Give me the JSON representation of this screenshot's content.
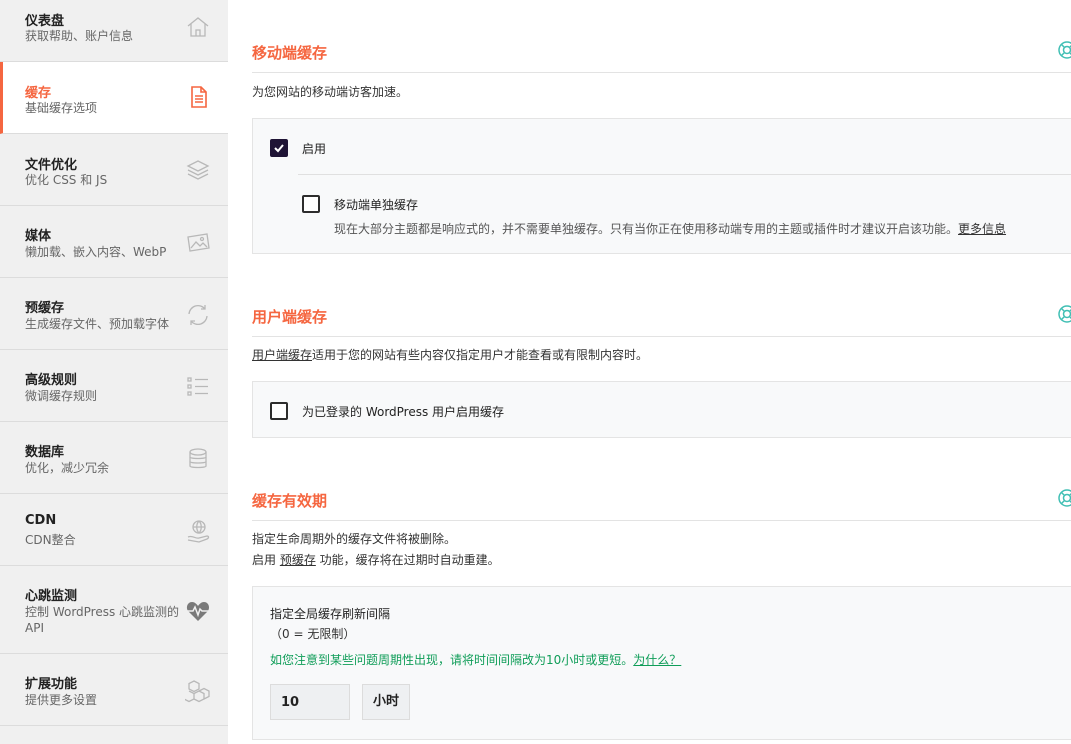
{
  "sidebar": {
    "items": [
      {
        "title": "仪表盘",
        "desc": "获取帮助、账户信息",
        "icon": "home-icon",
        "active": false
      },
      {
        "title": "缓存",
        "desc": "基础缓存选项",
        "icon": "file-icon",
        "active": true
      },
      {
        "title": "文件优化",
        "desc": "优化 CSS 和 JS",
        "icon": "layers-icon",
        "active": false
      },
      {
        "title": "媒体",
        "desc": "懒加载、嵌入内容、WebP",
        "icon": "image-icon",
        "active": false
      },
      {
        "title": "预缓存",
        "desc": "生成缓存文件、预加载字体",
        "icon": "refresh-icon",
        "active": false
      },
      {
        "title": "高级规则",
        "desc": "微调缓存规则",
        "icon": "list-icon",
        "active": false
      },
      {
        "title": "数据库",
        "desc": "优化，减少冗余",
        "icon": "database-icon",
        "active": false
      },
      {
        "title": "CDN",
        "desc": "CDN整合",
        "icon": "globe-hand-icon",
        "active": false
      },
      {
        "title": "心跳监测",
        "desc": "控制 WordPress 心跳监测的 API",
        "icon": "heartbeat-icon",
        "active": false
      },
      {
        "title": "扩展功能",
        "desc": "提供更多设置",
        "icon": "cubes-icon",
        "active": false
      }
    ]
  },
  "mobile_cache": {
    "title": "移动端缓存",
    "desc": "为您网站的移动端访客加速。",
    "enable_label": "启用",
    "enable_checked": true,
    "separate_label": "移动端单独缓存",
    "separate_checked": false,
    "separate_desc": "现在大部分主题都是响应式的，并不需要单独缓存。只有当你正在使用移动端专用的主题或插件时才建议开启该功能。",
    "more_info": "更多信息"
  },
  "user_cache": {
    "title": "用户端缓存",
    "desc_link": "用户端缓存",
    "desc_rest": "适用于您的网站有些内容仅指定用户才能查看或有限制内容时。",
    "option_label": "为已登录的 WordPress 用户启用缓存",
    "option_checked": false
  },
  "cache_lifespan": {
    "title": "缓存有效期",
    "desc_line1": "指定生命周期外的缓存文件将被删除。",
    "desc_line2_prefix": "启用 ",
    "desc_line2_link": "预缓存",
    "desc_line2_suffix": " 功能，缓存将在过期时自动重建。",
    "field_label": "指定全局缓存刷新间隔",
    "field_hint": "（0 = 无限制）",
    "note": "如您注意到某些问题周期性出现，请将时间间隔改为10小时或更短。",
    "note_link": "为什么？",
    "value": "10",
    "unit": "小时"
  },
  "colors": {
    "accent": "#f56640",
    "checkbox_checked": "#1f1435",
    "note_green": "#0f9d58",
    "help_teal": "#40bfb4"
  }
}
